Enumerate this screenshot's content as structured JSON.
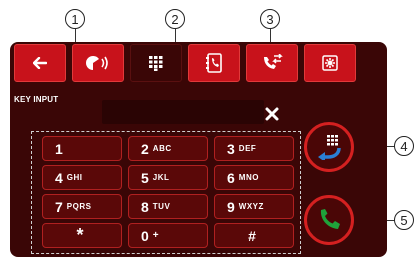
{
  "callouts": [
    "1",
    "2",
    "3",
    "4",
    "5"
  ],
  "toolbar": {
    "items": [
      {
        "icon": "back-arrow-icon",
        "active": false
      },
      {
        "icon": "door-release-icon",
        "active": false
      },
      {
        "icon": "keypad-icon",
        "active": true
      },
      {
        "icon": "phonebook-icon",
        "active": false
      },
      {
        "icon": "call-log-icon",
        "active": false
      },
      {
        "icon": "settings-icon",
        "active": false
      }
    ]
  },
  "key_input_label": "KEY INPUT",
  "input_value": "",
  "keypad": {
    "keys": [
      {
        "digit": "1",
        "letters": ""
      },
      {
        "digit": "2",
        "letters": "ABC"
      },
      {
        "digit": "3",
        "letters": "DEF"
      },
      {
        "digit": "4",
        "letters": "GHI"
      },
      {
        "digit": "5",
        "letters": "JKL"
      },
      {
        "digit": "6",
        "letters": "MNO"
      },
      {
        "digit": "7",
        "letters": "PQRS"
      },
      {
        "digit": "8",
        "letters": "TUV"
      },
      {
        "digit": "9",
        "letters": "WXYZ"
      },
      {
        "digit": "*",
        "letters": ""
      },
      {
        "digit": "0",
        "letters": "+"
      },
      {
        "digit": "#",
        "letters": ""
      }
    ]
  },
  "colors": {
    "accent": "#c8121b",
    "panel": "#3a0606",
    "call_green": "#1fa23a",
    "transfer_blue": "#2a7fd4"
  }
}
